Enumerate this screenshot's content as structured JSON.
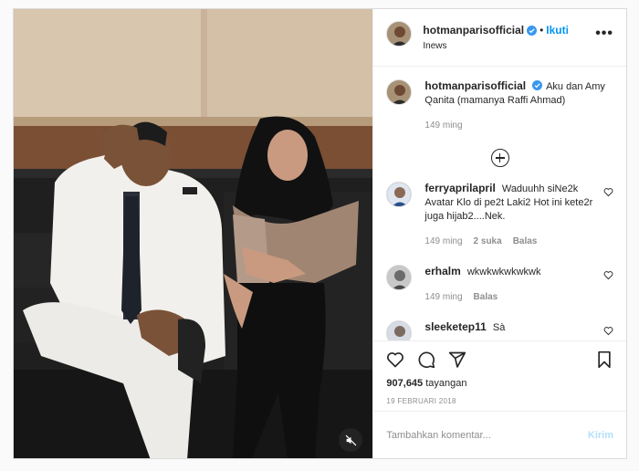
{
  "post": {
    "author": {
      "username": "hotmanparisofficial",
      "follow_label": "Ikuti",
      "separator": "•",
      "location": "Inews"
    },
    "more_icon": "more-options-icon",
    "caption": {
      "username": "hotmanparisofficial",
      "text": "Aku dan Amy Qanita (mamanya Raffi Ahmad)",
      "time": "149 ming"
    },
    "comments": [
      {
        "username": "ferryaprilapril",
        "text": "Waduuhh siNe2k Avatar Klo di pe2t Laki2 Hot ini kete2r juga hijab2....Nek.",
        "time": "149 ming",
        "likes": "2 suka",
        "reply": "Balas",
        "avatar_color": "#4a6a9a"
      },
      {
        "username": "erhalm",
        "text": "wkwkwkwkwkwk",
        "time": "149 ming",
        "likes": "",
        "reply": "Balas",
        "avatar_color": "#9a9a9a"
      },
      {
        "username": "sleeketep11",
        "text": "Sà",
        "time": "",
        "likes": "",
        "reply": "",
        "avatar_color": "#7a8aa0"
      }
    ],
    "views_count": "907,645",
    "views_label": "tayangan",
    "date": "19 FEBRUARI 2018",
    "comment_input": {
      "placeholder": "Tambahkan komentar...",
      "send_label": "Kirim"
    },
    "colors": {
      "link": "#0095f6",
      "muted": "#8e8e8e",
      "send_disabled": "#b2dffc",
      "verified": "#3897f0"
    }
  }
}
